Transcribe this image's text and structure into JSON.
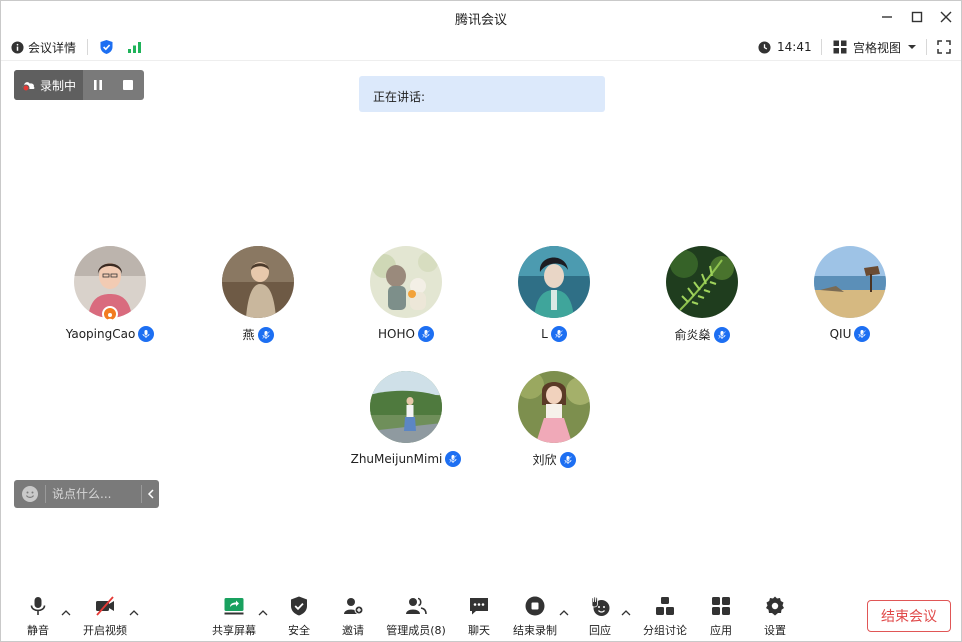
{
  "window": {
    "title": "腾讯会议"
  },
  "infobar": {
    "details_label": "会议详情",
    "time": "14:41",
    "view_label": "宫格视图"
  },
  "recording": {
    "label": "录制中"
  },
  "speaking": {
    "label": "正在讲话:"
  },
  "participants": [
    {
      "name": "YaopingCao",
      "host": true,
      "avatar": "person-pink-jacket"
    },
    {
      "name": "燕",
      "host": false,
      "avatar": "child-photo"
    },
    {
      "name": "HOHO",
      "host": false,
      "avatar": "cartoon-figure"
    },
    {
      "name": "L",
      "host": false,
      "avatar": "anime-character"
    },
    {
      "name": "俞炎燊",
      "host": false,
      "avatar": "green-fern"
    },
    {
      "name": "QIU",
      "host": false,
      "avatar": "beach-scene"
    },
    {
      "name": "ZhuMeijunMimi",
      "host": false,
      "avatar": "person-road"
    },
    {
      "name": "刘欣",
      "host": false,
      "avatar": "person-garden"
    }
  ],
  "chat": {
    "placeholder": "说点什么..."
  },
  "toolbar": {
    "mute": "静音",
    "video": "开启视频",
    "share": "共享屏幕",
    "security": "安全",
    "invite": "邀请",
    "members": "管理成员(8)",
    "chat": "聊天",
    "stop_record": "结束录制",
    "reaction": "回应",
    "breakout": "分组讨论",
    "apps": "应用",
    "settings": "设置",
    "end_meeting": "结束会议"
  },
  "colors": {
    "accent_blue": "#1d6ff2",
    "signal_green": "#1fb35a",
    "share_green": "#19a15f",
    "end_red": "#e04a4a",
    "speaking_bg": "#dce9fb"
  }
}
